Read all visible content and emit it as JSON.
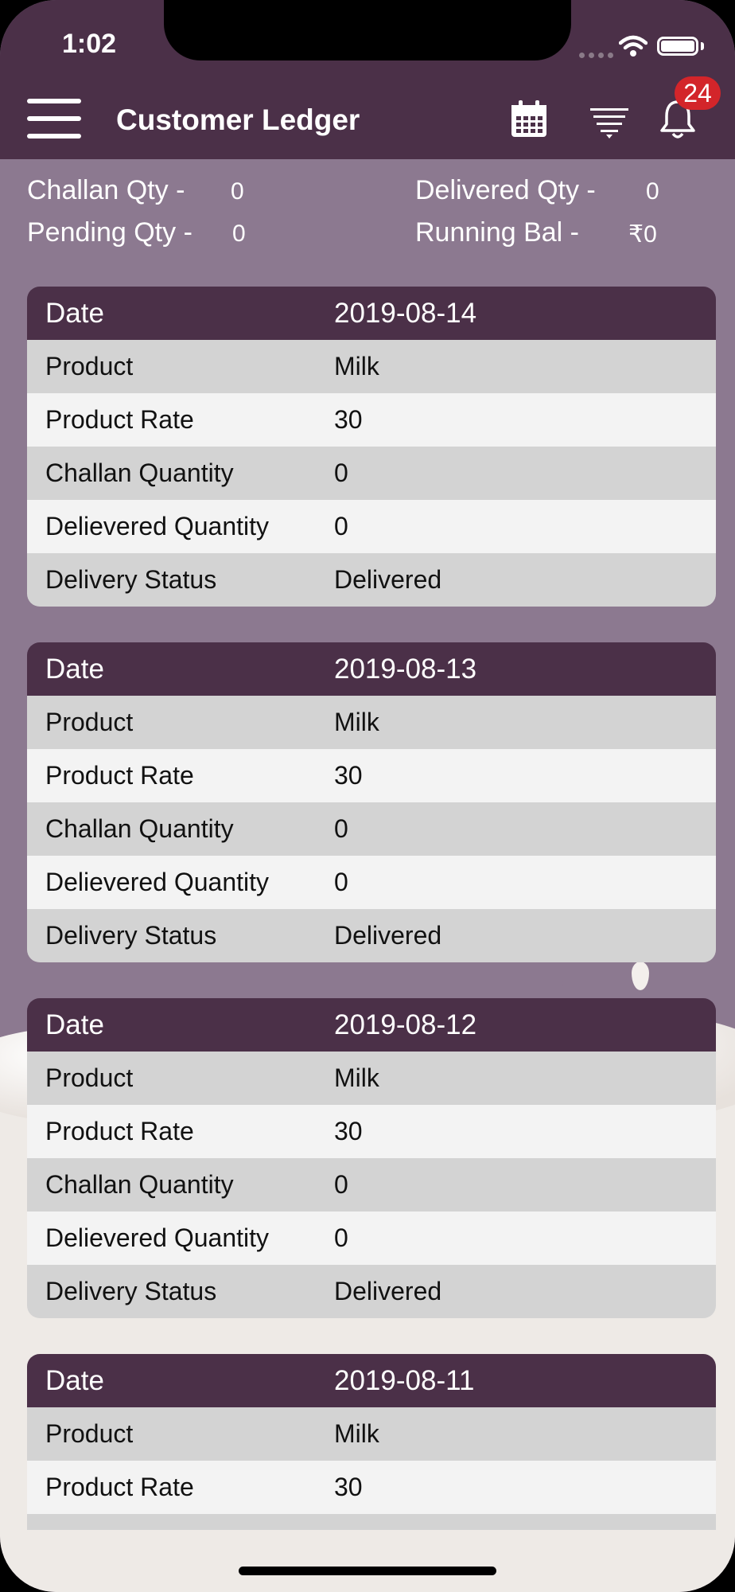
{
  "status_bar": {
    "time": "1:02"
  },
  "header": {
    "title": "Customer Ledger",
    "notification_count": "24"
  },
  "icons": [
    "menu-icon",
    "calendar-icon",
    "filter-icon",
    "bell-icon"
  ],
  "colors": {
    "header_bg": "#4b3048",
    "page_bg": "#8c7990",
    "badge": "#d3252a",
    "row_odd": "#d3d3d3",
    "row_even": "#f3f3f3"
  },
  "summary": {
    "challan_qty_label": "Challan Qty -",
    "challan_qty_value": "0",
    "delivered_qty_label": "Delivered Qty -",
    "delivered_qty_value": "0",
    "pending_qty_label": "Pending Qty -",
    "pending_qty_value": "0",
    "running_bal_label": "Running Bal -",
    "running_bal_value": "₹0"
  },
  "labels": {
    "date": "Date",
    "product": "Product",
    "product_rate": "Product Rate",
    "challan_quantity": "Challan Quantity",
    "delivered_quantity": "Delievered Quantity",
    "delivery_status": "Delivery Status"
  },
  "entries": [
    {
      "date": "2019-08-14",
      "product": "Milk",
      "product_rate": "30",
      "challan_quantity": "0",
      "delivered_quantity": "0",
      "delivery_status": "Delivered"
    },
    {
      "date": "2019-08-13",
      "product": "Milk",
      "product_rate": "30",
      "challan_quantity": "0",
      "delivered_quantity": "0",
      "delivery_status": "Delivered"
    },
    {
      "date": "2019-08-12",
      "product": "Milk",
      "product_rate": "30",
      "challan_quantity": "0",
      "delivered_quantity": "0",
      "delivery_status": "Delivered"
    },
    {
      "date": "2019-08-11",
      "product": "Milk",
      "product_rate": "30"
    }
  ]
}
